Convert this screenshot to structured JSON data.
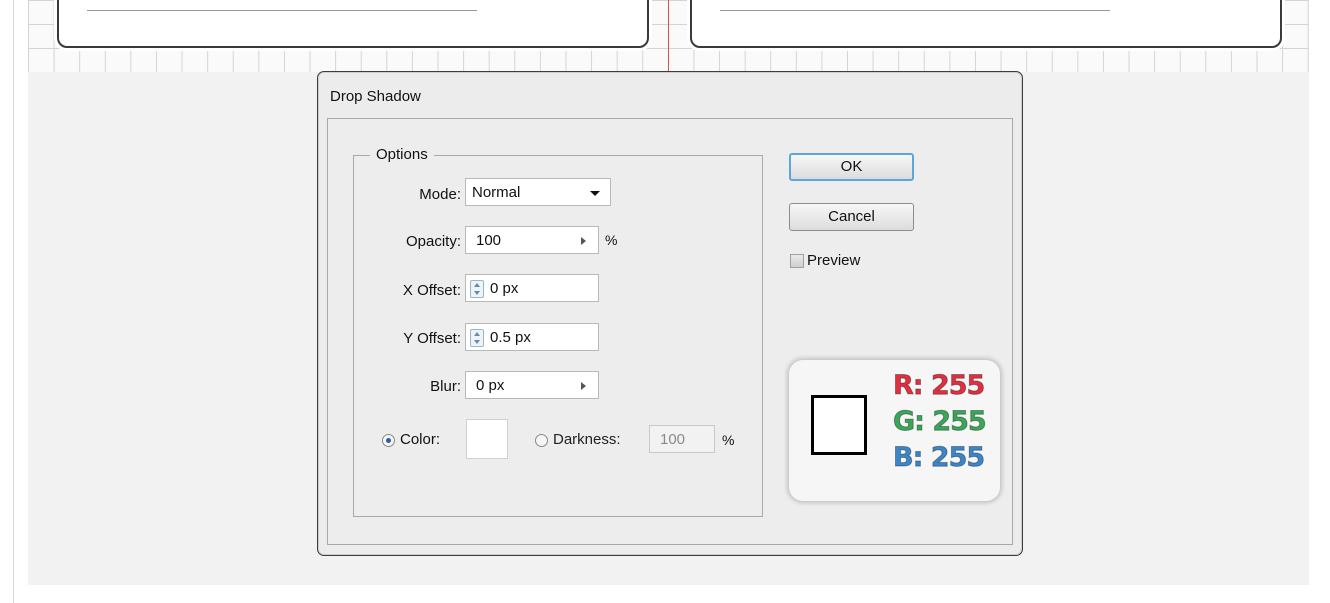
{
  "dialog": {
    "title": "Drop Shadow",
    "options_legend": "Options",
    "mode": {
      "label": "Mode:",
      "value": "Normal"
    },
    "opacity": {
      "label": "Opacity:",
      "value": "100",
      "unit": "%"
    },
    "x_offset": {
      "label": "X Offset:",
      "value": "0 px"
    },
    "y_offset": {
      "label": "Y Offset:",
      "value": "0.5 px"
    },
    "blur": {
      "label": "Blur:",
      "value": "0 px"
    },
    "color_option": {
      "label": "Color:",
      "selected": true,
      "swatch": "#ffffff"
    },
    "darkness_option": {
      "label": "Darkness:",
      "value": "100",
      "unit": "%",
      "selected": false
    },
    "ok_label": "OK",
    "cancel_label": "Cancel",
    "preview_label": "Preview"
  },
  "rgb_badge": {
    "swatch": "#ffffff",
    "r": "R: 255",
    "g": "G: 255",
    "b": "B: 255"
  },
  "colors": {
    "guide": "#e05050",
    "ok_focus": "#5fa6d8",
    "r": "#e0303f",
    "g": "#3aa65a",
    "b": "#3a86c8"
  }
}
